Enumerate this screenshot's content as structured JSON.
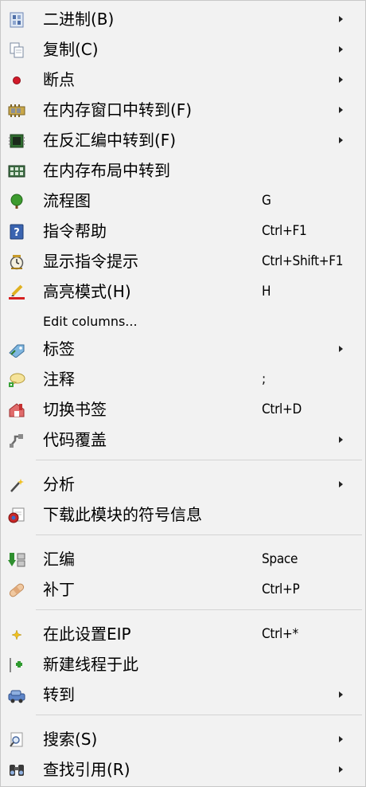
{
  "menu": {
    "items": [
      {
        "label": "二进制(B)",
        "shortcut": "",
        "icon": "binary-icon",
        "submenu": true
      },
      {
        "label": "复制(C)",
        "shortcut": "",
        "icon": "copy-icon",
        "submenu": true
      },
      {
        "label": "断点",
        "shortcut": "",
        "icon": "breakpoint-icon",
        "submenu": true
      },
      {
        "label": "在内存窗口中转到(F)",
        "shortcut": "",
        "icon": "memory-window-icon",
        "submenu": true
      },
      {
        "label": "在反汇编中转到(F)",
        "shortcut": "",
        "icon": "disassembly-icon",
        "submenu": true
      },
      {
        "label": "在内存布局中转到",
        "shortcut": "",
        "icon": "memory-map-icon",
        "submenu": false
      },
      {
        "label": "流程图",
        "shortcut": "G",
        "icon": "graph-tree-icon",
        "submenu": false
      },
      {
        "label": "指令帮助",
        "shortcut": "Ctrl+F1",
        "icon": "help-icon",
        "submenu": false
      },
      {
        "label": "显示指令提示",
        "shortcut": "Ctrl+Shift+F1",
        "icon": "hint-icon",
        "submenu": false
      },
      {
        "label": "高亮模式(H)",
        "shortcut": "H",
        "icon": "highlight-icon",
        "submenu": false
      },
      {
        "label": "Edit columns...",
        "shortcut": "",
        "icon": "",
        "submenu": false
      },
      {
        "label": "标签",
        "shortcut": "",
        "icon": "label-icon",
        "submenu": true
      },
      {
        "label": "注释",
        "shortcut": ";",
        "icon": "comment-icon",
        "submenu": false
      },
      {
        "label": "切换书签",
        "shortcut": "Ctrl+D",
        "icon": "bookmark-icon",
        "submenu": false
      },
      {
        "label": "代码覆盖",
        "shortcut": "",
        "icon": "coverage-icon",
        "submenu": true
      },
      {
        "label": "分析",
        "shortcut": "",
        "icon": "analysis-icon",
        "submenu": true
      },
      {
        "label": "下载此模块的符号信息",
        "shortcut": "",
        "icon": "download-symbols-icon",
        "submenu": false
      },
      {
        "label": "汇编",
        "shortcut": "Space",
        "icon": "assemble-icon",
        "submenu": false
      },
      {
        "label": "补丁",
        "shortcut": "Ctrl+P",
        "icon": "patch-icon",
        "submenu": false
      },
      {
        "label": "在此设置EIP",
        "shortcut": "Ctrl+*",
        "icon": "set-eip-icon",
        "submenu": false
      },
      {
        "label": "新建线程于此",
        "shortcut": "",
        "icon": "new-thread-icon",
        "submenu": false
      },
      {
        "label": "转到",
        "shortcut": "",
        "icon": "goto-icon",
        "submenu": true
      },
      {
        "label": "搜索(S)",
        "shortcut": "",
        "icon": "search-icon",
        "submenu": true
      },
      {
        "label": "查找引用(R)",
        "shortcut": "",
        "icon": "references-icon",
        "submenu": true
      }
    ]
  }
}
